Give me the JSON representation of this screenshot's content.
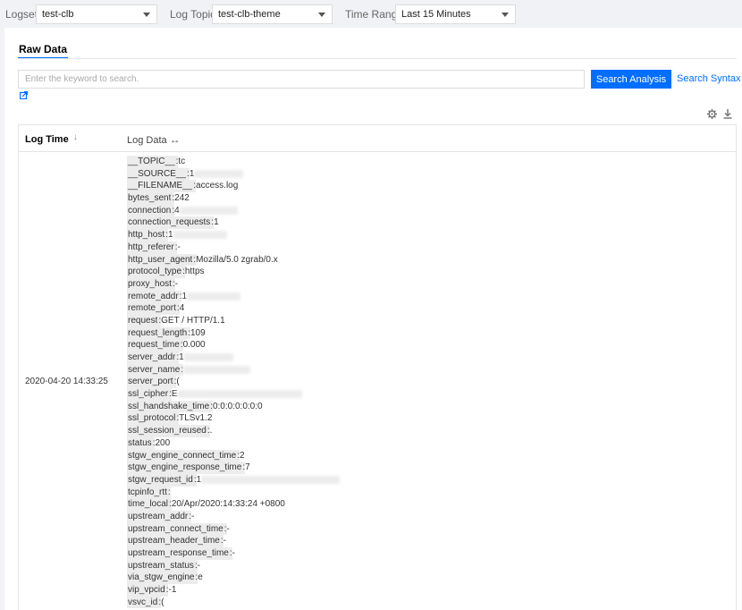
{
  "filters": {
    "logset_label": "Logset",
    "logset_value": "test-clb",
    "topic_label": "Log Topic",
    "topic_value": "test-clb-theme",
    "range_label": "Time Range",
    "range_value": "Last 15 Minutes"
  },
  "tabs": [
    "Raw Data"
  ],
  "search": {
    "placeholder": "Enter the keyword to search.",
    "button_label": "Search Analysis",
    "syntax_link": "Search Syntax"
  },
  "table": {
    "col_time": "Log Time",
    "col_time_sort_icon": "↓",
    "col_data": "Log Data",
    "col_data_expand_icon": "↔",
    "log_time": "2020-04-20 14:33:25",
    "fields": [
      {
        "key": "__TOPIC__",
        "value": "tc"
      },
      {
        "key": "__SOURCE__",
        "value": "1"
      },
      {
        "key": "__FILENAME__",
        "value": "access.log"
      },
      {
        "key": "bytes_sent",
        "value": "242"
      },
      {
        "key": "connection",
        "value": "4"
      },
      {
        "key": "connection_requests",
        "value": "1"
      },
      {
        "key": "http_host",
        "value": "1"
      },
      {
        "key": "http_referer",
        "value": "-"
      },
      {
        "key": "http_user_agent",
        "value": "Mozilla/5.0 zgrab/0.x"
      },
      {
        "key": "protocol_type",
        "value": "https"
      },
      {
        "key": "proxy_host",
        "value": "-"
      },
      {
        "key": "remote_addr",
        "value": "1"
      },
      {
        "key": "remote_port",
        "value": "4"
      },
      {
        "key": "request",
        "value": "GET / HTTP/1.1"
      },
      {
        "key": "request_length",
        "value": "109"
      },
      {
        "key": "request_time",
        "value": "0.000"
      },
      {
        "key": "server_addr",
        "value": "1"
      },
      {
        "key": "server_name",
        "value": ""
      },
      {
        "key": "server_port",
        "value": "("
      },
      {
        "key": "ssl_cipher",
        "value": "E"
      },
      {
        "key": "ssl_handshake_time",
        "value": "0:0:0:0:0:0:0"
      },
      {
        "key": "ssl_protocol",
        "value": "TLSv1.2"
      },
      {
        "key": "ssl_session_reused",
        "value": "."
      },
      {
        "key": "status",
        "value": "200"
      },
      {
        "key": "stgw_engine_connect_time",
        "value": "2"
      },
      {
        "key": "stgw_engine_response_time",
        "value": "7"
      },
      {
        "key": "stgw_request_id",
        "value": "1"
      },
      {
        "key": "tcpinfo_rtt",
        "value": ""
      },
      {
        "key": "time_local",
        "value": "20/Apr/2020:14:33:24 +0800"
      },
      {
        "key": "upstream_addr",
        "value": "-"
      },
      {
        "key": "upstream_connect_time",
        "value": "-"
      },
      {
        "key": "upstream_header_time",
        "value": "-"
      },
      {
        "key": "upstream_response_time",
        "value": "-"
      },
      {
        "key": "upstream_status",
        "value": "-"
      },
      {
        "key": "via_stgw_engine",
        "value": "e"
      },
      {
        "key": "vip_vpcid",
        "value": "-1"
      },
      {
        "key": "vsvc_id",
        "value": "("
      }
    ]
  }
}
